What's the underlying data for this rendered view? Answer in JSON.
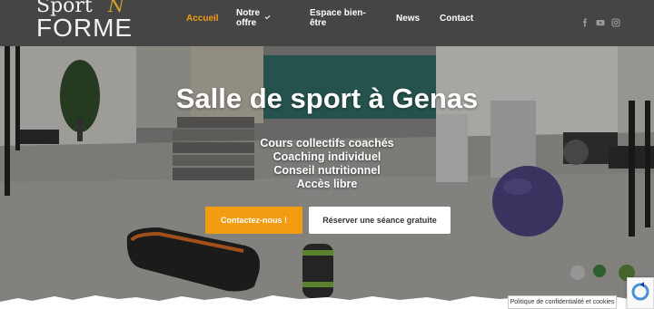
{
  "logo": {
    "line1": "Sport",
    "accent": "N",
    "line2": "FORME"
  },
  "nav": {
    "items": [
      {
        "label": "Accueil"
      },
      {
        "label": "Notre offre"
      },
      {
        "label": "Espace bien-être"
      },
      {
        "label": "News"
      },
      {
        "label": "Contact"
      }
    ]
  },
  "social": [
    "facebook-icon",
    "youtube-icon",
    "instagram-icon"
  ],
  "hero": {
    "title": "Salle de sport à Genas",
    "lines": [
      "Cours collectifs coachés",
      "Coaching individuel",
      "Conseil nutritionnel",
      "Accès libre"
    ],
    "cta_primary": "Contactez-nous !",
    "cta_secondary": "Réserver une séance gratuite"
  },
  "privacy": "Politique de confidentialité et cookies",
  "colors": {
    "header": "#454545",
    "accent": "#f39c12",
    "white": "#ffffff"
  }
}
